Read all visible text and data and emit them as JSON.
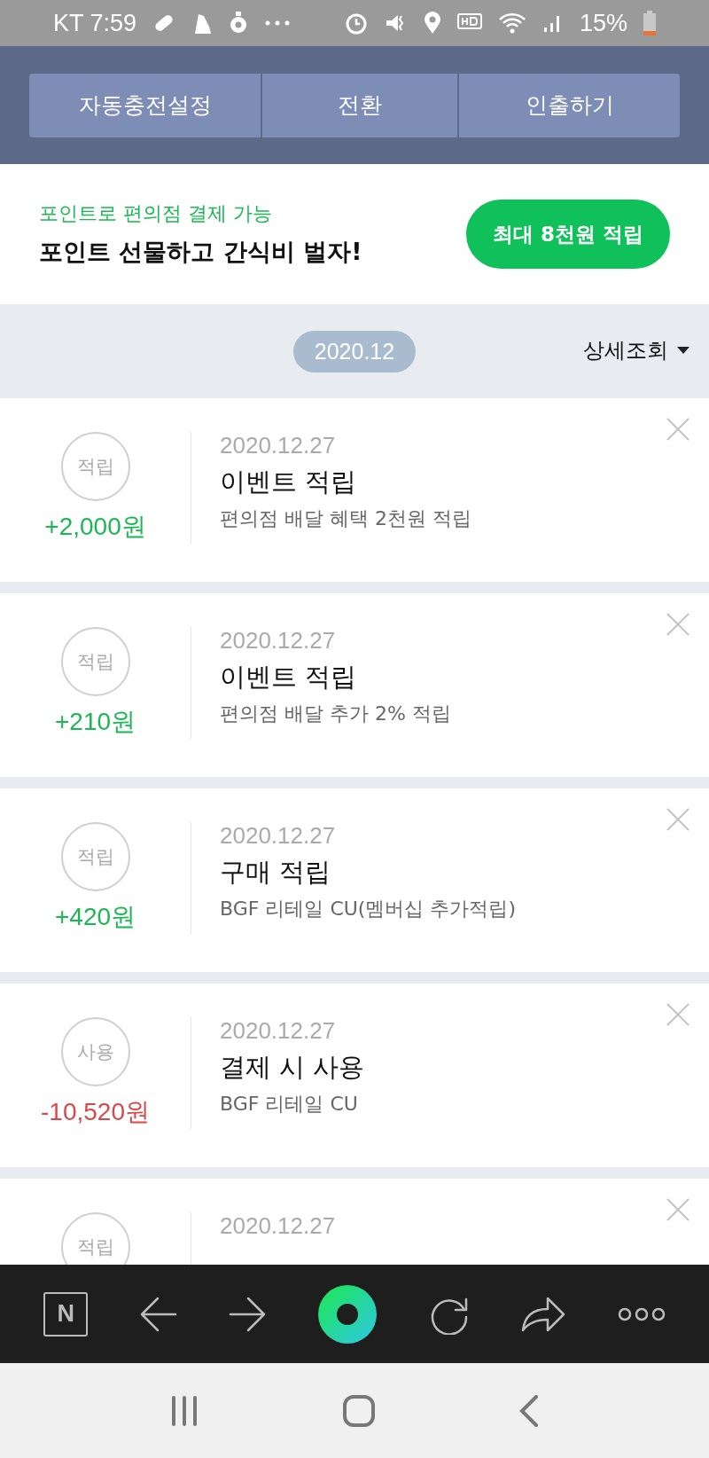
{
  "status_bar": {
    "carrier_time": "KT 7:59",
    "battery": "15%"
  },
  "header_buttons": [
    "자동충전설정",
    "전환",
    "인출하기"
  ],
  "promo": {
    "subtitle": "포인트로 편의점 결제 가능",
    "title": "포인트 선물하고 간식비 벌자!",
    "button": "최대 8천원 적립"
  },
  "month_bar": {
    "month": "2020.12",
    "filter": "상세조회"
  },
  "entries": [
    {
      "kind": "earn",
      "badge": "적립",
      "amount": "+2,000원",
      "date": "2020.12.27",
      "title": "이벤트 적립",
      "detail": "편의점 배달 혜택 2천원 적립"
    },
    {
      "kind": "earn",
      "badge": "적립",
      "amount": "+210원",
      "date": "2020.12.27",
      "title": "이벤트 적립",
      "detail": "편의점 배달 추가 2% 적립"
    },
    {
      "kind": "earn",
      "badge": "적립",
      "amount": "+420원",
      "date": "2020.12.27",
      "title": "구매 적립",
      "detail": "BGF 리테일 CU(멤버십 추가적립)"
    },
    {
      "kind": "use",
      "badge": "사용",
      "amount": "-10,520원",
      "date": "2020.12.27",
      "title": "결제 시 사용",
      "detail": "BGF 리테일 CU"
    },
    {
      "badge": "적립",
      "date": "2020.12.27"
    }
  ],
  "browser_bar": {
    "logo": "N"
  }
}
